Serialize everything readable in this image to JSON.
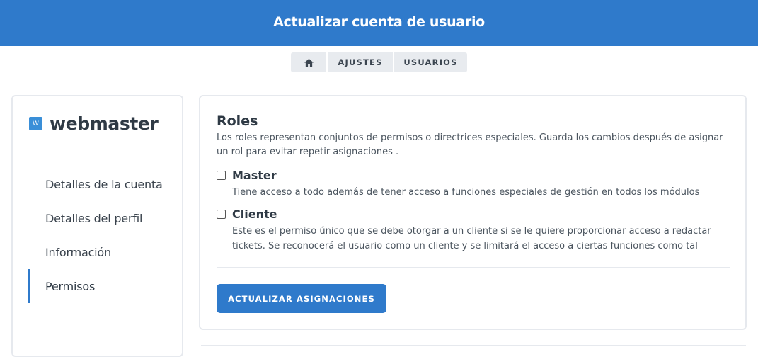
{
  "header": {
    "title": "Actualizar cuenta de usuario"
  },
  "breadcrumb": {
    "home_icon": "home-icon",
    "items": [
      {
        "label": "AJUSTES"
      },
      {
        "label": "USUARIOS"
      }
    ]
  },
  "sidebar": {
    "brand_badge": "W",
    "brand_name": "webmaster",
    "items": [
      {
        "label": "Detalles de la cuenta",
        "active": false
      },
      {
        "label": "Detalles del perfil",
        "active": false
      },
      {
        "label": "Información",
        "active": false
      },
      {
        "label": "Permisos",
        "active": true
      }
    ]
  },
  "roles": {
    "title": "Roles",
    "description": "Los roles representan conjuntos de permisos o directrices especiales. Guarda los cambios después de asignar un rol para evitar repetir asignaciones .",
    "items": [
      {
        "name": "Master",
        "checked": false,
        "description": "Tiene acceso a todo además de tener acceso a funciones especiales de gestión en todos los módulos"
      },
      {
        "name": "Cliente",
        "checked": false,
        "description": "Este es el permiso único que se debe otorgar a un cliente si se le quiere proporcionar acceso a redactar tickets. Se reconocerá el usuario como un cliente y se limitará el acceso a ciertas funciones como tal"
      }
    ],
    "submit_label": "ACTUALIZAR ASIGNACIONES"
  },
  "colors": {
    "primary": "#2f7acb",
    "border": "#e6e9ee"
  }
}
